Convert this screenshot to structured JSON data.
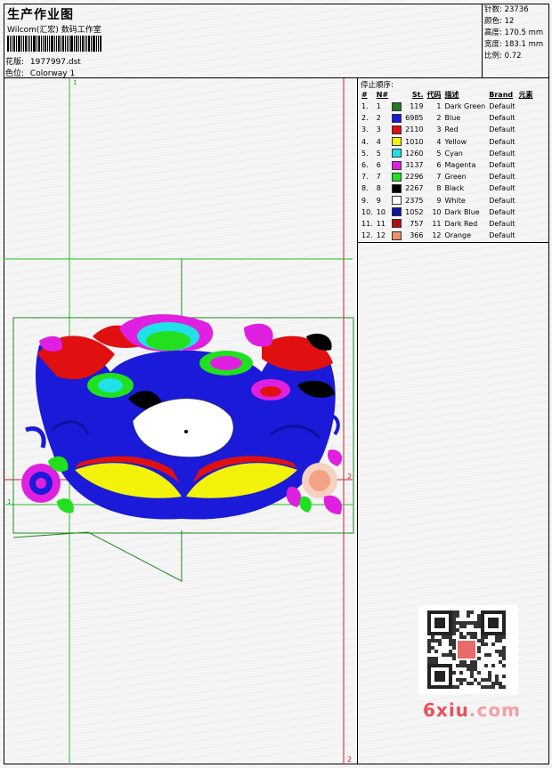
{
  "header": {
    "title": "生产作业图",
    "studio": "Wilcom(汇宏) 数码工作室",
    "pattern_label": "花版:",
    "pattern_value": "1977997.dst",
    "color_label": "色位:",
    "color_value": "Colorway 1"
  },
  "stats": {
    "stitches_label": "针数:",
    "stitches_value": "23736",
    "colors_label": "颜色:",
    "colors_value": "12",
    "height_label": "高度:",
    "height_value": "170.5 mm",
    "width_label": "宽度:",
    "width_value": "183.1 mm",
    "scale_label": "比例:",
    "scale_value": "0.72"
  },
  "stop_table": {
    "title": "停止顺序:",
    "columns": [
      "#",
      "N#",
      "St.",
      "代码",
      "描述",
      "Brand",
      "元素"
    ],
    "rows": [
      {
        "idx": "1.",
        "n": "1",
        "color": "#1f7a1f",
        "st": "119",
        "code": "1",
        "desc": "Dark Green",
        "brand": "Default"
      },
      {
        "idx": "2.",
        "n": "2",
        "color": "#1a1ad8",
        "st": "6985",
        "code": "2",
        "desc": "Blue",
        "brand": "Default"
      },
      {
        "idx": "3.",
        "n": "3",
        "color": "#e01010",
        "st": "2110",
        "code": "3",
        "desc": "Red",
        "brand": "Default"
      },
      {
        "idx": "4.",
        "n": "4",
        "color": "#f2f20a",
        "st": "1010",
        "code": "4",
        "desc": "Yellow",
        "brand": "Default"
      },
      {
        "idx": "5.",
        "n": "5",
        "color": "#20e0e8",
        "st": "1260",
        "code": "5",
        "desc": "Cyan",
        "brand": "Default"
      },
      {
        "idx": "6.",
        "n": "6",
        "color": "#e020e0",
        "st": "3137",
        "code": "6",
        "desc": "Magenta",
        "brand": "Default"
      },
      {
        "idx": "7.",
        "n": "7",
        "color": "#20e020",
        "st": "2296",
        "code": "7",
        "desc": "Green",
        "brand": "Default"
      },
      {
        "idx": "8.",
        "n": "8",
        "color": "#000000",
        "st": "2267",
        "code": "8",
        "desc": "Black",
        "brand": "Default"
      },
      {
        "idx": "9.",
        "n": "9",
        "color": "#ffffff",
        "st": "2375",
        "code": "9",
        "desc": "White",
        "brand": "Default"
      },
      {
        "idx": "10.",
        "n": "10",
        "color": "#1010a0",
        "st": "1052",
        "code": "10",
        "desc": "Dark Blue",
        "brand": "Default"
      },
      {
        "idx": "11.",
        "n": "11",
        "color": "#b01010",
        "st": "757",
        "code": "11",
        "desc": "Dark Red",
        "brand": "Default"
      },
      {
        "idx": "12.",
        "n": "12",
        "color": "#f0906a",
        "st": "366",
        "code": "12",
        "desc": "Orange",
        "brand": "Default"
      }
    ]
  },
  "guides": {
    "marker_1": "1",
    "marker_2": "2"
  },
  "watermark": {
    "prefix": "6xiu",
    "suffix": ".com"
  }
}
